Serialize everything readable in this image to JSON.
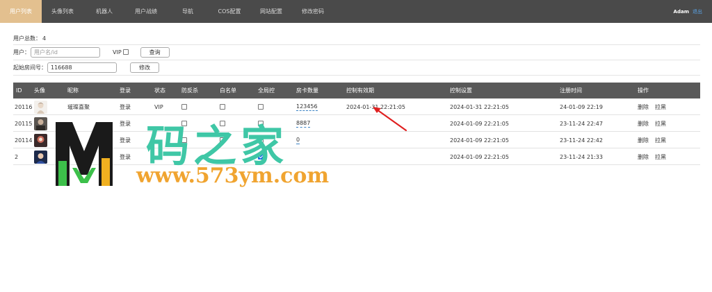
{
  "nav": {
    "items": [
      "用户列表",
      "头像列表",
      "机器人",
      "用户战绩",
      "导航",
      "COS配置",
      "网站配置",
      "修改密码"
    ],
    "active_index": 0,
    "user": "Adam",
    "logout": "退出"
  },
  "summary": {
    "total_label": "用户总数：",
    "total_value": "4"
  },
  "search": {
    "user_label": "用户：",
    "user_placeholder": "用户名/id",
    "vip_label": "VIP",
    "query_button": "查询"
  },
  "start_room": {
    "label": "起始房间号：",
    "value": "116688",
    "button": "修改"
  },
  "table": {
    "headers": [
      "ID",
      "头像",
      "昵称",
      "登录",
      "状态",
      "防反杀",
      "白名单",
      "全局控",
      "房卡数量",
      "控制有效期",
      "控制设置",
      "注册时间",
      "操作"
    ],
    "rows": [
      {
        "id": "20116",
        "nickname": "璀璨喜聚",
        "login": "登录",
        "status": "VIP",
        "anti_kill": false,
        "whitelist": false,
        "global_ctrl": false,
        "cards": "123456",
        "ctrl_valid": "2024-01-31 22:21:05",
        "ctrl_set": "2024-01-31 22:21:05",
        "reg_time": "24-01-09 22:19"
      },
      {
        "id": "20115",
        "nickname": "",
        "login": "登录",
        "status": "",
        "anti_kill": false,
        "whitelist": false,
        "global_ctrl": false,
        "cards": "8887",
        "ctrl_valid": "",
        "ctrl_set": "2024-01-09 22:21:05",
        "reg_time": "23-11-24 22:47"
      },
      {
        "id": "20114",
        "nickname": "",
        "login": "登录",
        "status": "",
        "anti_kill": false,
        "whitelist": false,
        "global_ctrl": false,
        "cards": "0",
        "ctrl_valid": "",
        "ctrl_set": "2024-01-09 22:21:05",
        "reg_time": "23-11-24 22:42"
      },
      {
        "id": "2",
        "nickname": "",
        "login": "登录",
        "status": "",
        "anti_kill": false,
        "whitelist": false,
        "global_ctrl": true,
        "cards": "",
        "ctrl_valid": "",
        "ctrl_set": "2024-01-09 22:21:05",
        "reg_time": "23-11-24 21:33"
      }
    ],
    "op_delete": "删除",
    "op_blacklist": "拉黑"
  },
  "watermark": {
    "title": "码之家",
    "url": "www.573ym.com"
  },
  "colors": {
    "nav_bg": "#4a4a4a",
    "nav_active": "#e3c08f",
    "thead_bg": "#595959",
    "annotation_arrow": "#e02020"
  }
}
